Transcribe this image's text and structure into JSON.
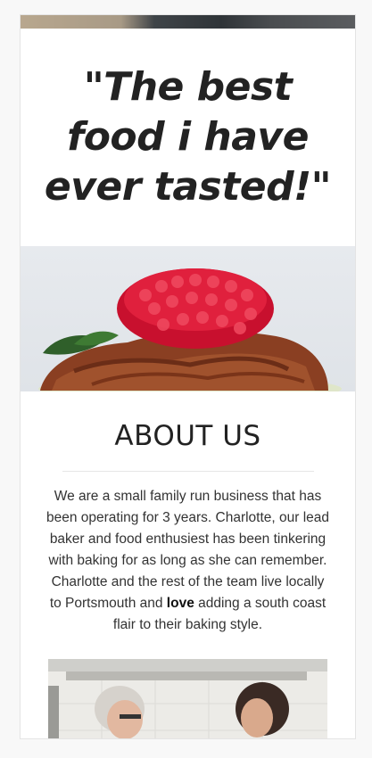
{
  "quote": {
    "text": "\"The best food i have ever tasted!\""
  },
  "images": {
    "top_strip": "hero-image-partial",
    "cake": "raspberry-chocolate-cupcake-photo",
    "kitchen": "bakers-in-kitchen-photo"
  },
  "about": {
    "title": "ABOUT US",
    "paragraph_before_bold": "We are a small family run business that has been operating for 3 years. Charlotte, our lead baker and food enthusiest has been tinkering with baking for as long as she can remember. Charlotte and the rest of the team live locally to Portsmouth and ",
    "bold_word": "love",
    "paragraph_after_bold": " adding a south coast flair to their baking style."
  },
  "colors": {
    "page_background": "#f8f8f8",
    "card_background": "#ffffff",
    "text": "#222222",
    "divider": "#e6e6e6"
  }
}
